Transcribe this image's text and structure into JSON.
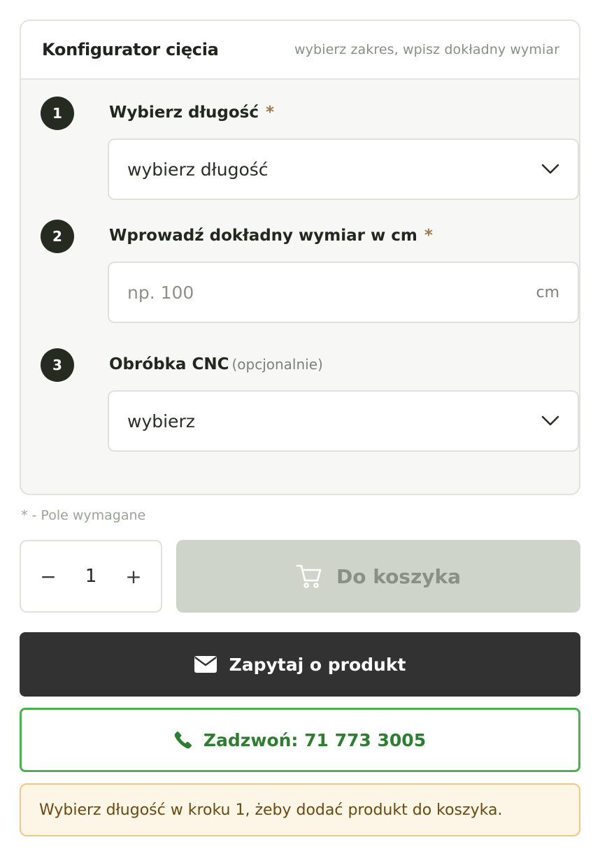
{
  "configurator": {
    "title": "Konfigurator cięcia",
    "hint": "wybierz zakres, wpisz dokładny wymiar"
  },
  "steps": [
    {
      "number": "1",
      "label": "Wybierz długość",
      "required_mark": "*",
      "select_value": "wybierz długość"
    },
    {
      "number": "2",
      "label": "Wprowadź dokładny wymiar w cm",
      "required_mark": "*",
      "input_placeholder": "np. 100",
      "unit": "cm"
    },
    {
      "number": "3",
      "label": "Obróbka CNC",
      "optional_note": "(opcjonalnie)",
      "select_value": "wybierz"
    }
  ],
  "required_note": "* - Pole wymagane",
  "quantity": {
    "decrement": "−",
    "value": "1",
    "increment": "+"
  },
  "cart_button": {
    "label": "Do koszyka",
    "icon": "cart-icon",
    "state": "disabled"
  },
  "ask_button": {
    "label": "Zapytaj o produkt",
    "icon": "envelope-icon"
  },
  "call_button": {
    "label": "Zadzwoń: 71 773 3005",
    "icon": "phone-icon"
  },
  "alert": {
    "text": "Wybierz długość w kroku 1, żeby dodać produkt do koszyka."
  },
  "colors": {
    "step_badge": "#262b22",
    "required_asterisk": "#a0784a",
    "cart_disabled_bg": "#cfd4cb",
    "ask_button_bg": "#323232",
    "call_accent": "#4caf50",
    "call_text": "#2f7d32",
    "alert_bg": "#fdf5e6",
    "alert_border": "#ecc98a"
  }
}
